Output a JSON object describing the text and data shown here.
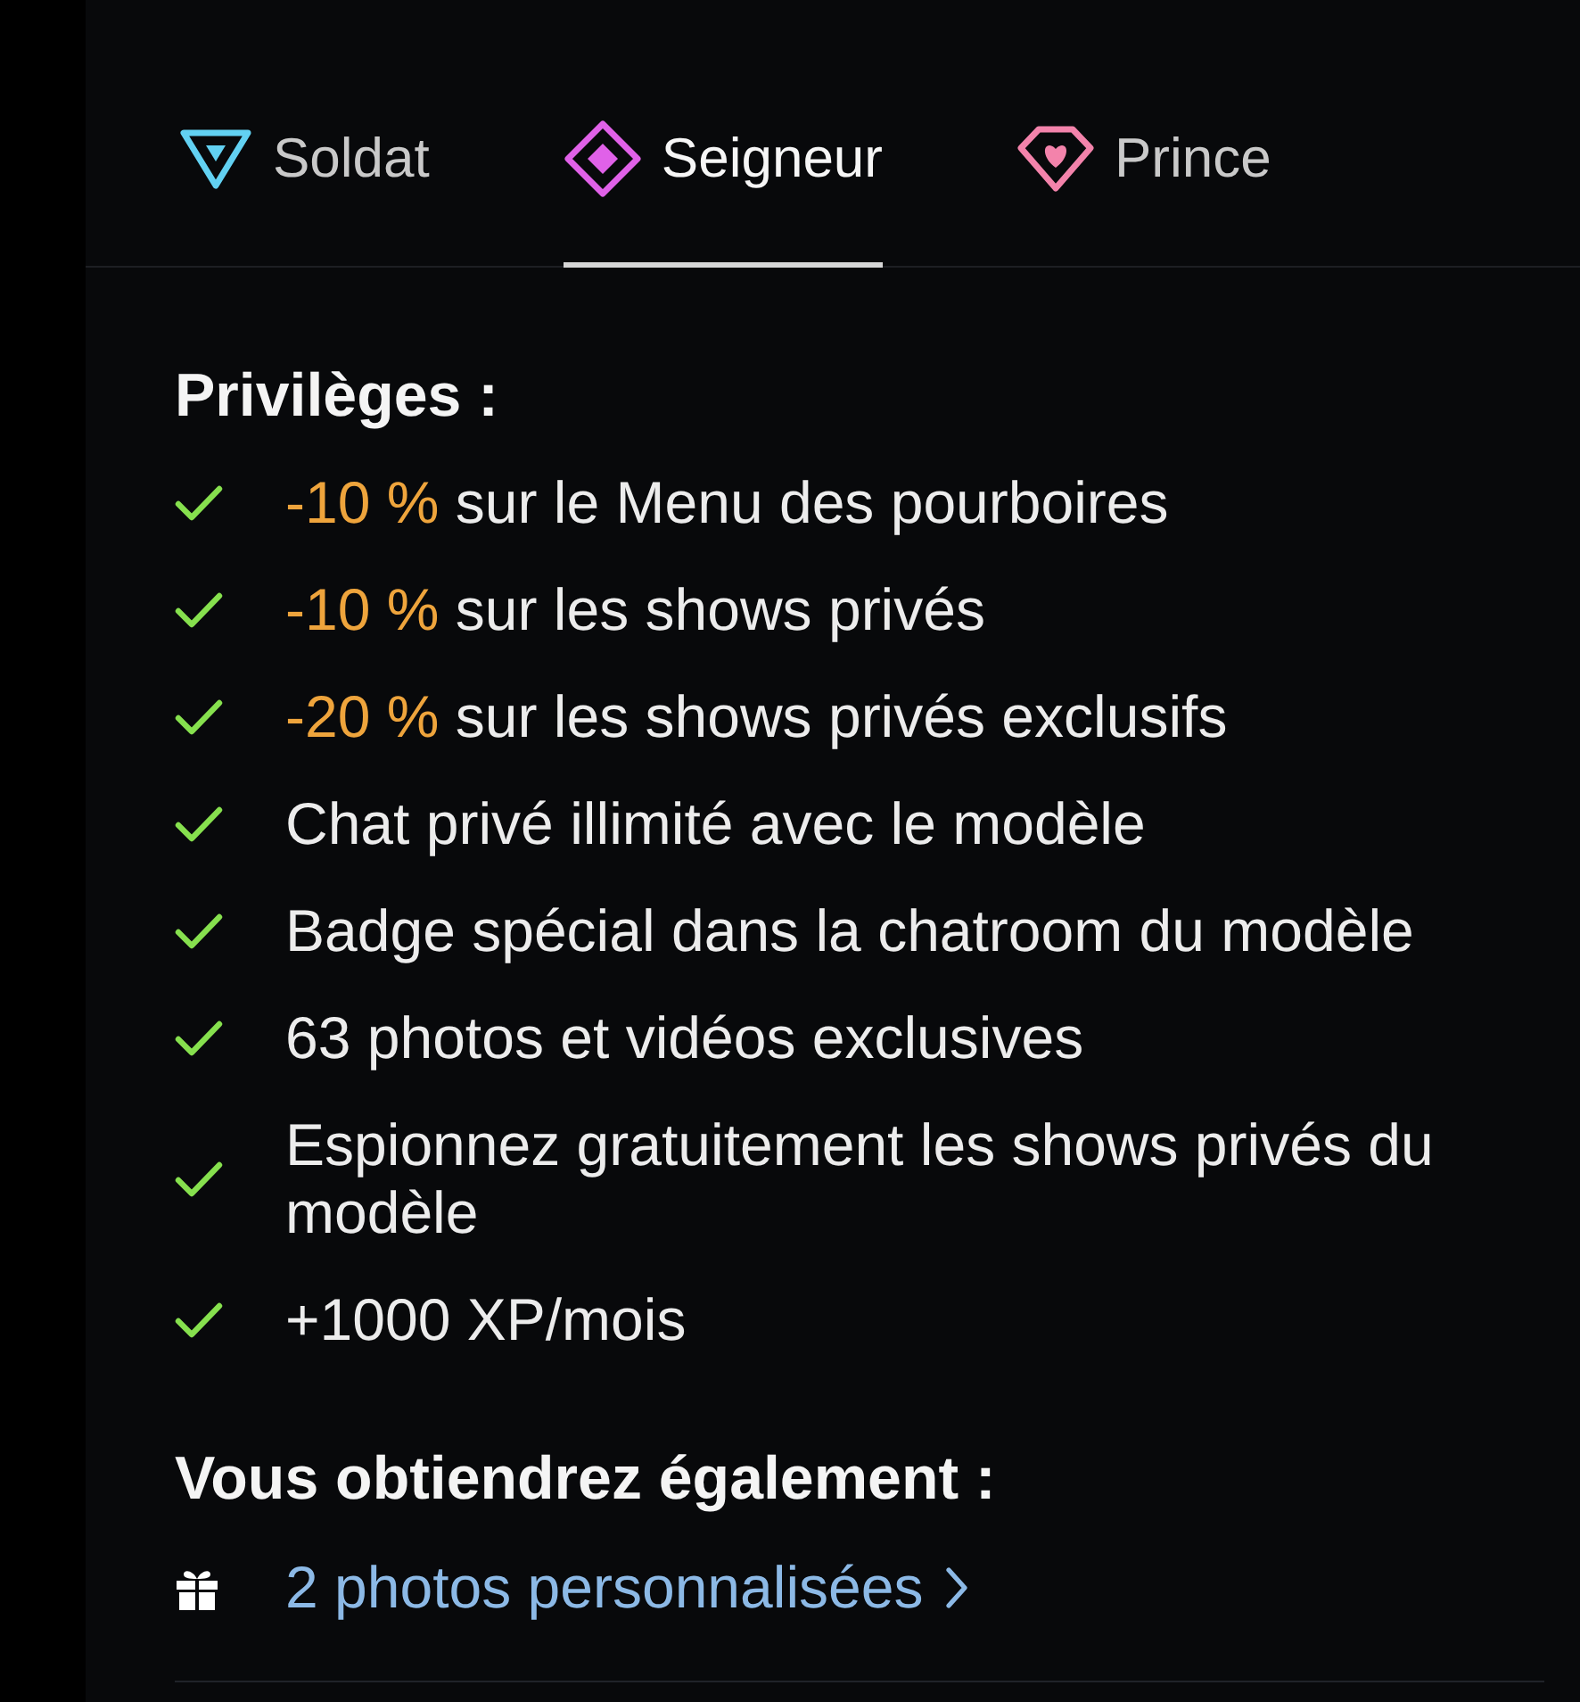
{
  "tabs": [
    {
      "label": "Soldat",
      "selected": false,
      "kind": "triangle",
      "color": "#62d1f2"
    },
    {
      "label": "Seigneur",
      "selected": true,
      "kind": "diamond",
      "color": "#e061e8"
    },
    {
      "label": "Prince",
      "selected": false,
      "kind": "gem",
      "color": "#f383ab"
    }
  ],
  "privileges": {
    "title": "Privilèges :",
    "items": [
      {
        "discount": "-10 %",
        "text": "sur le Menu des pourboires"
      },
      {
        "discount": "-10 %",
        "text": "sur les shows privés"
      },
      {
        "discount": "-20 %",
        "text": "sur les shows privés exclusifs"
      },
      {
        "text": "Chat privé illimité avec le modèle"
      },
      {
        "text": "Badge spécial dans la chatroom du modèle"
      },
      {
        "text": "63 photos et vidéos exclusives"
      },
      {
        "text": "Espionnez gratuitement les shows privés du modèle"
      },
      {
        "text": "+1000 XP/mois"
      }
    ]
  },
  "extras": {
    "title": "Vous obtiendrez également :",
    "items": [
      {
        "label": "2 photos personnalisées"
      }
    ]
  }
}
